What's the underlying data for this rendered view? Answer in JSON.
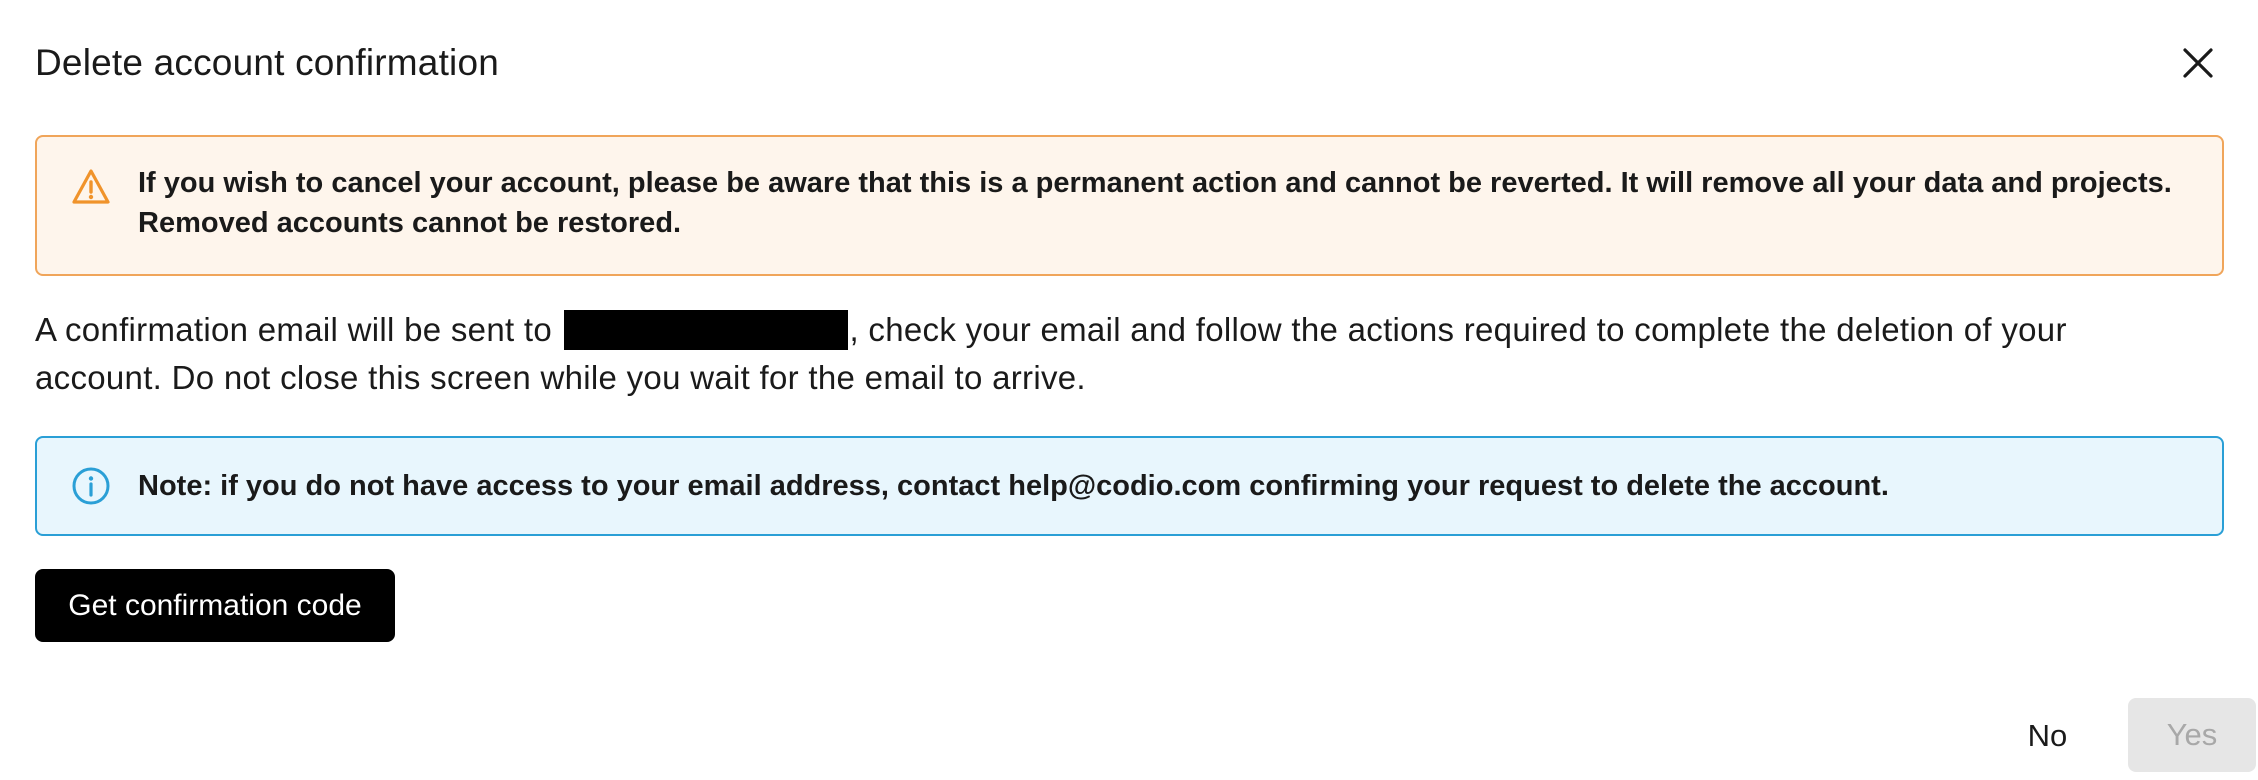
{
  "dialog": {
    "title": "Delete account confirmation",
    "close_icon": "close-icon"
  },
  "warning": {
    "icon": "warning-triangle-icon",
    "text": "If you wish to cancel your account, please be aware that this is a permanent action and cannot be reverted. It will remove all your data and projects. Removed accounts cannot be restored.",
    "background_color": "#fef5ec",
    "border_color": "#f0a55a",
    "icon_color": "#f0932b"
  },
  "body": {
    "text_before_email": "A confirmation email will be sent to ",
    "text_after_email": ", check your email and follow the actions required to complete the deletion of your account. Do not close this screen while you wait for the email to arrive."
  },
  "note": {
    "icon": "info-icon",
    "text": "Note: if you do not have access to your email address, contact help@codio.com confirming your request to delete the account.",
    "background_color": "#e8f6fd",
    "border_color": "#2a9fd6"
  },
  "actions": {
    "get_code_label": "Get confirmation code",
    "no_label": "No",
    "yes_label": "Yes"
  }
}
